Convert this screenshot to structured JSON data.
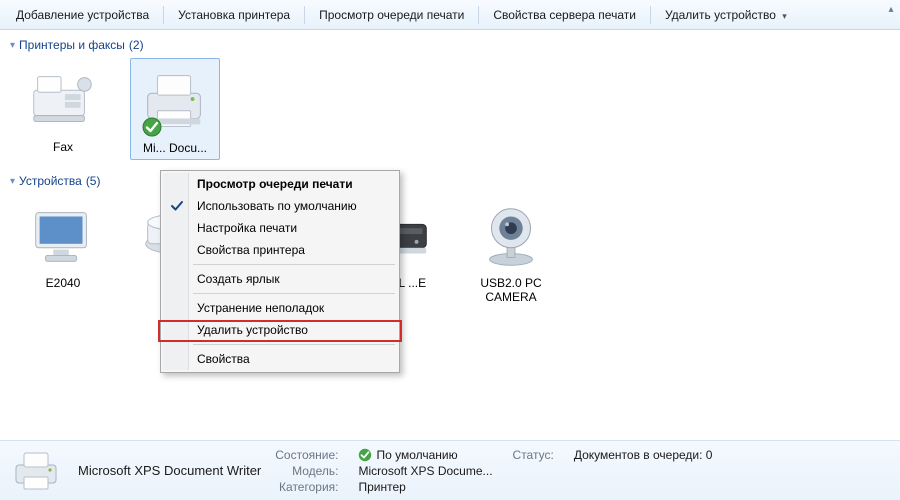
{
  "toolbar": {
    "add_device": "Добавление устройства",
    "add_printer": "Установка принтера",
    "view_queue": "Просмотр очереди печати",
    "server_props": "Свойства сервера печати",
    "remove_device": "Удалить устройство"
  },
  "groups": {
    "printers_faxes": {
      "label": "Принтеры и факсы",
      "count": "(2)"
    },
    "devices": {
      "label": "Устройства",
      "count": "(5)"
    }
  },
  "items": {
    "fax": "Fax",
    "xps": "Microsoft XPS Docu...",
    "xps_short": "Mi... Docu...",
    "e2040": "E2040",
    "optical_partial": "...CAL ...E",
    "cam": "USB2.0 PC CAMERA"
  },
  "context_menu": {
    "view_queue": "Просмотр очереди печати",
    "use_default": "Использовать по умолчанию",
    "printing_prefs": "Настройка печати",
    "printer_props": "Свойства принтера",
    "create_shortcut": "Создать ярлык",
    "troubleshoot": "Устранение неполадок",
    "remove_device": "Удалить устройство",
    "properties": "Свойства"
  },
  "status": {
    "title": "Microsoft XPS Document Writer",
    "state_label": "Состояние:",
    "state_value": "По умолчанию",
    "model_label": "Модель:",
    "model_value": "Microsoft XPS Docume...",
    "category_label": "Категория:",
    "category_value": "Принтер",
    "status_label": "Статус:",
    "status_value": "Документов в очереди: 0"
  }
}
